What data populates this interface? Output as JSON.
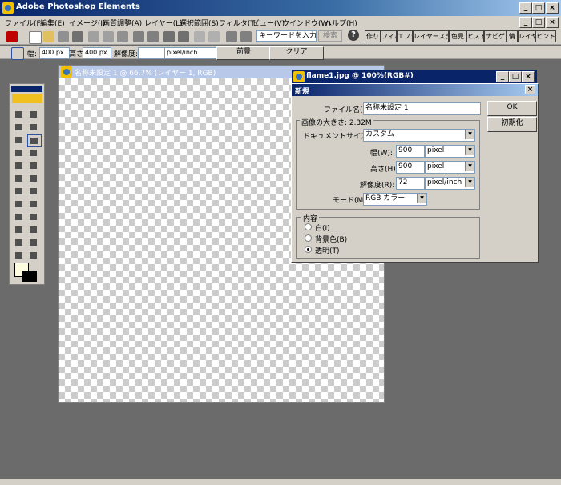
{
  "app": {
    "title": "Adobe Photoshop Elements"
  },
  "menu": [
    "ファイル(F)",
    "編集(E)",
    "イメージ(I)",
    "画質調整(A)",
    "レイヤー(L)",
    "選択範囲(S)",
    "フィルタ(T)",
    "ビュー(V)",
    "ウインドウ(W)",
    "ヘルプ(H)"
  ],
  "toolbar": {
    "search_placeholder": "キーワードを入力",
    "search_button": "検索",
    "palette_tabs": [
      "作り",
      "フィル",
      "エフェ",
      "レイヤースタイ",
      "色見",
      "ヒスト",
      "ナビゲ",
      "情",
      "レイヤ",
      "ヒント"
    ]
  },
  "options": {
    "width_label": "幅:",
    "width_value": "400 px",
    "height_label": "高さ:",
    "height_value": "400 px",
    "res_label": "解像度:",
    "res_value": "",
    "res_unit": "pixel/inch",
    "front_button": "前景",
    "clear_button": "クリア"
  },
  "document": {
    "title": "名称未設定 1 @ 66.7% (レイヤー 1, RGB)"
  },
  "image_window": {
    "title": "flame1.jpg @ 100%(RGB#)"
  },
  "dialog": {
    "title": "新規",
    "filename_label": "ファイル名(N):",
    "filename_value": "名称未設定 1",
    "ok": "OK",
    "reset": "初期化",
    "image_size_label": "画像の大きさ: 2.32M",
    "doc_size_label": "ドキュメントサイズ(P):",
    "doc_size_value": "カスタム",
    "width_label": "幅(W):",
    "width_value": "900",
    "width_unit": "pixel",
    "height_label": "高さ(H):",
    "height_value": "900",
    "height_unit": "pixel",
    "res_label": "解像度(R):",
    "res_value": "72",
    "res_unit": "pixel/inch",
    "mode_label": "モード(M):",
    "mode_value": "RGB カラー",
    "contents_label": "内容",
    "contents": [
      {
        "label": "白(I)",
        "selected": false
      },
      {
        "label": "背景色(B)",
        "selected": false
      },
      {
        "label": "透明(T)",
        "selected": true
      }
    ]
  },
  "colors": {
    "title_dark": "#0a246a",
    "chrome": "#d4d0c8",
    "workspace": "#6b6b6b"
  }
}
